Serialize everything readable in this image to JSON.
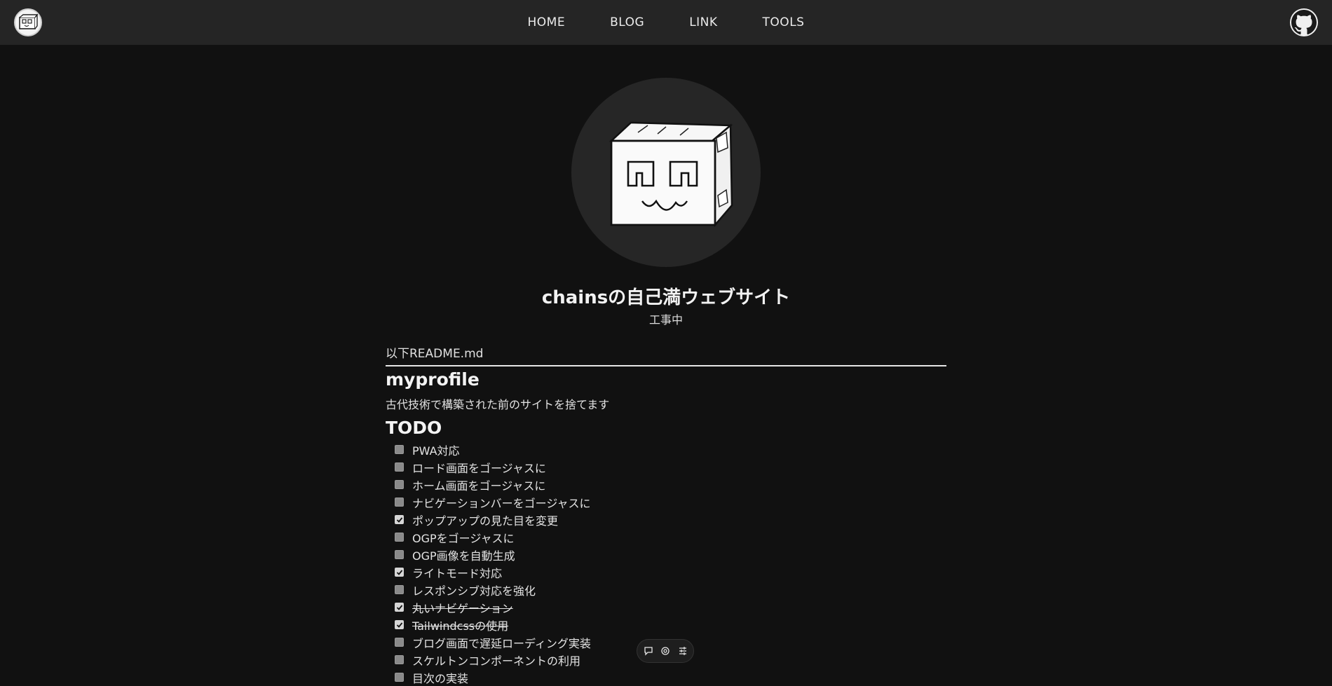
{
  "nav": {
    "items": [
      "HOME",
      "BLOG",
      "LINK",
      "TOOLS"
    ]
  },
  "icons": {
    "logo": "cardboard-box-logo-icon",
    "github": "github-icon",
    "float": [
      "comment-icon",
      "ring-icon",
      "list-icon"
    ]
  },
  "colors": {
    "background": "#111111",
    "topbar": "#252525",
    "text": "#e6e6e6"
  },
  "profile": {
    "title": "chainsの自己満ウェブサイト",
    "subtitle": "工事中"
  },
  "readme": {
    "label": "以下README.md",
    "heading": "myprofile",
    "description": "古代技術で構築された前のサイトを捨てます",
    "todo_heading": "TODO",
    "todos": [
      {
        "text": "PWA対応",
        "checked": false,
        "struck": false
      },
      {
        "text": "ロード画面をゴージャスに",
        "checked": false,
        "struck": false
      },
      {
        "text": "ホーム画面をゴージャスに",
        "checked": false,
        "struck": false
      },
      {
        "text": "ナビゲーションバーをゴージャスに",
        "checked": false,
        "struck": false
      },
      {
        "text": "ポップアップの見た目を変更",
        "checked": true,
        "struck": false
      },
      {
        "text": "OGPをゴージャスに",
        "checked": false,
        "struck": false
      },
      {
        "text": "OGP画像を自動生成",
        "checked": false,
        "struck": false
      },
      {
        "text": "ライトモード対応",
        "checked": true,
        "struck": false
      },
      {
        "text": "レスポンシブ対応を強化",
        "checked": false,
        "struck": false
      },
      {
        "text": "丸いナビゲーション",
        "checked": true,
        "struck": true
      },
      {
        "text": "Tailwindcssの使用",
        "checked": true,
        "struck": true
      },
      {
        "text": "ブログ画面で遅延ローディング実装",
        "checked": false,
        "struck": false
      },
      {
        "text": "スケルトンコンポーネントの利用",
        "checked": false,
        "struck": false
      },
      {
        "text": "目次の実装",
        "checked": false,
        "struck": false
      }
    ]
  }
}
